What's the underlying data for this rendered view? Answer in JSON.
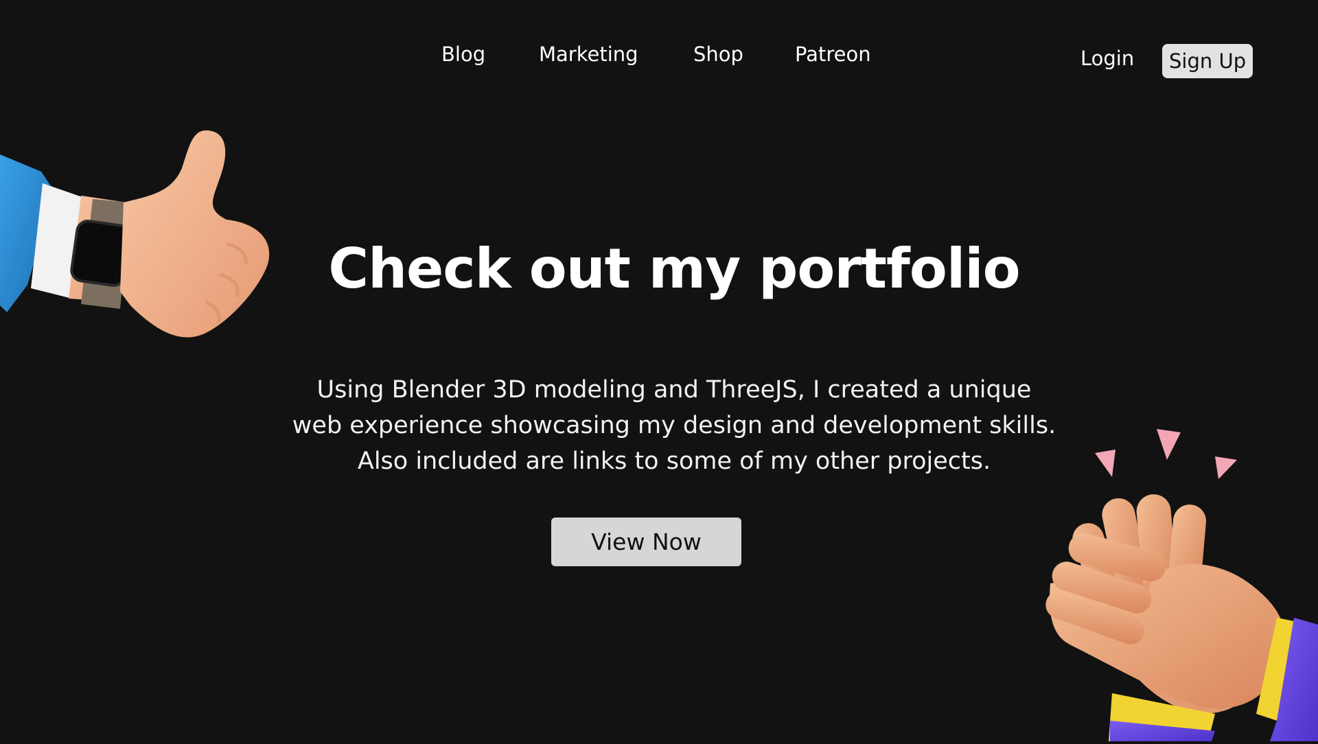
{
  "nav": {
    "items": [
      {
        "label": "Blog"
      },
      {
        "label": "Marketing"
      },
      {
        "label": "Shop"
      },
      {
        "label": "Patreon"
      }
    ],
    "login_label": "Login",
    "signup_label": "Sign Up"
  },
  "hero": {
    "title": "Check out my portfolio",
    "description_lines": [
      "Using Blender 3D modeling and ThreeJS, I created a unique",
      "web experience showcasing my design and development skills.",
      "Also included are links to some of my other projects."
    ],
    "cta_label": "View Now"
  },
  "illustrations": {
    "left": "thumbs-up-hand-icon",
    "right": "clapping-hands-icon"
  },
  "colors": {
    "background": "#121212",
    "text": "#ffffff",
    "button_bg": "#d6d6d6",
    "signup_bg": "#e2e2e2",
    "sleeve_blue": "#2f8fd6",
    "sleeve_purple": "#6a4ae8",
    "skin": "#f0b48e"
  }
}
